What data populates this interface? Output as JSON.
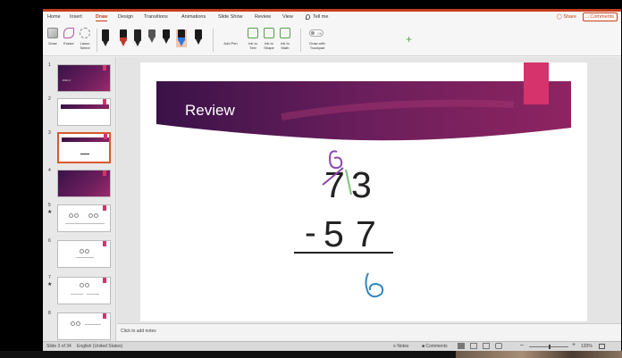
{
  "ribbon": {
    "tabs": [
      {
        "label": "Home"
      },
      {
        "label": "Insert"
      },
      {
        "label": "Draw",
        "active": true
      },
      {
        "label": "Design"
      },
      {
        "label": "Transitions"
      },
      {
        "label": "Animations"
      },
      {
        "label": "Slide Show"
      },
      {
        "label": "Review"
      },
      {
        "label": "View"
      }
    ],
    "tell_me": "Tell me",
    "share": "Share",
    "comments": "Comments",
    "tools": {
      "draw": "Draw",
      "eraser": "Eraser",
      "lasso": "Lasso Select",
      "add_pen": "Add Pen",
      "ink_to_text": "Ink to Text",
      "ink_to_shape": "Ink to Shape",
      "ink_to_math": "Ink to Math",
      "draw_with_trackpad": "Draw with Trackpad",
      "toggle_state": "Off"
    },
    "pens": [
      {
        "color": "#1a1a1a"
      },
      {
        "color": "#c0392b"
      },
      {
        "color": "#222222"
      },
      {
        "color": "#555555"
      },
      {
        "color": "#1a1a1a"
      },
      {
        "color": "#2c7be5",
        "selected": true
      },
      {
        "color": "#1a1a1a"
      }
    ]
  },
  "thumbnails": [
    {
      "number": "1",
      "title": "POD 2"
    },
    {
      "number": "2"
    },
    {
      "number": "3",
      "selected": true
    },
    {
      "number": "4"
    },
    {
      "number": "5",
      "starred": true
    },
    {
      "number": "6"
    },
    {
      "number": "7",
      "starred": true
    },
    {
      "number": "8"
    }
  ],
  "slide": {
    "title": "Review",
    "problem": {
      "top_digits": [
        "7",
        "3"
      ],
      "bottom_digits": [
        "5",
        "7"
      ],
      "operator": "-",
      "ink_above": "6",
      "ink_answer": "6"
    },
    "colors": {
      "banner_dark": "#3a1248",
      "banner_mid": "#6b1e5c",
      "banner_light": "#9b2a6a",
      "pink_accent": "#d6336c",
      "ink_purple": "#8e44ad",
      "ink_green": "#7cc47a",
      "ink_blue": "#2e86c1"
    }
  },
  "notes": {
    "placeholder": "Click to add notes"
  },
  "status": {
    "slide_position": "Slide 3 of 34",
    "language": "English (United States)",
    "notes": "Notes",
    "comments": "Comments",
    "zoom": "120%"
  }
}
